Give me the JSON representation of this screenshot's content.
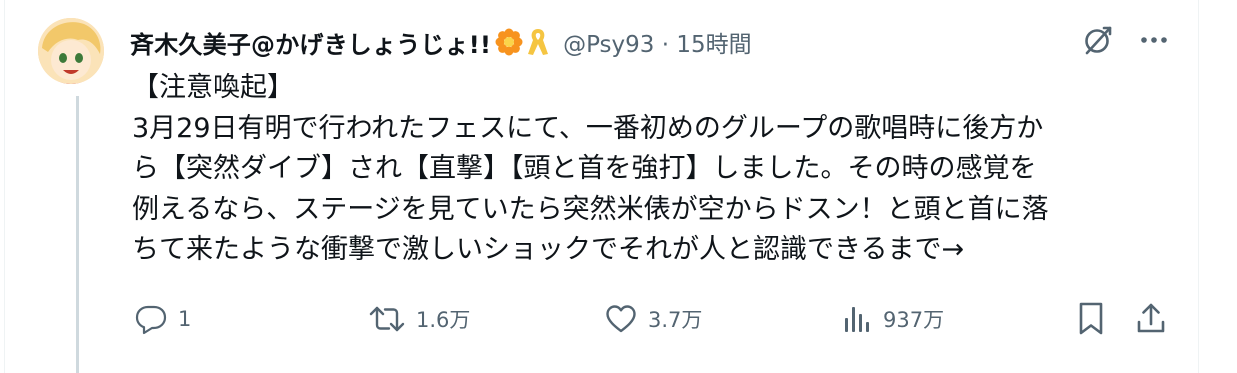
{
  "tweet": {
    "author_name": "斉木久美子@かげきしょうじょ!!",
    "handle": "@Psy93",
    "separator": " · ",
    "time": "15時間",
    "text_lines": [
      "【注意喚起】",
      "3月29日有明で行われたフェスにて、一番初めのグループの歌唱時に後方か",
      "ら【突然ダイブ】され【直撃】【頭と首を強打】しました。その時の感覚を",
      "例えるなら、ステージを見ていたら突然米俵が空からドスン！と頭と首に落",
      "ちて来たような衝撃で激しいショックでそれが人と認識できるまで→"
    ]
  },
  "actions": {
    "reply_count": "1",
    "retweet_count": "1.6万",
    "like_count": "3.7万",
    "view_count": "937万"
  },
  "icons": {
    "grok": "grok-icon",
    "more": "more-icon",
    "reply": "reply-icon",
    "retweet": "retweet-icon",
    "like": "heart-icon",
    "views": "views-icon",
    "bookmark": "bookmark-icon",
    "share": "share-icon",
    "badge_flower": "flower-emoji-icon",
    "badge_ribbon": "ribbon-emoji-icon"
  },
  "colors": {
    "text": "#0f1419",
    "secondary": "#536471",
    "thread_line": "#cfd9de",
    "ribbon": "#f5c542",
    "flower": "#f7931e"
  }
}
